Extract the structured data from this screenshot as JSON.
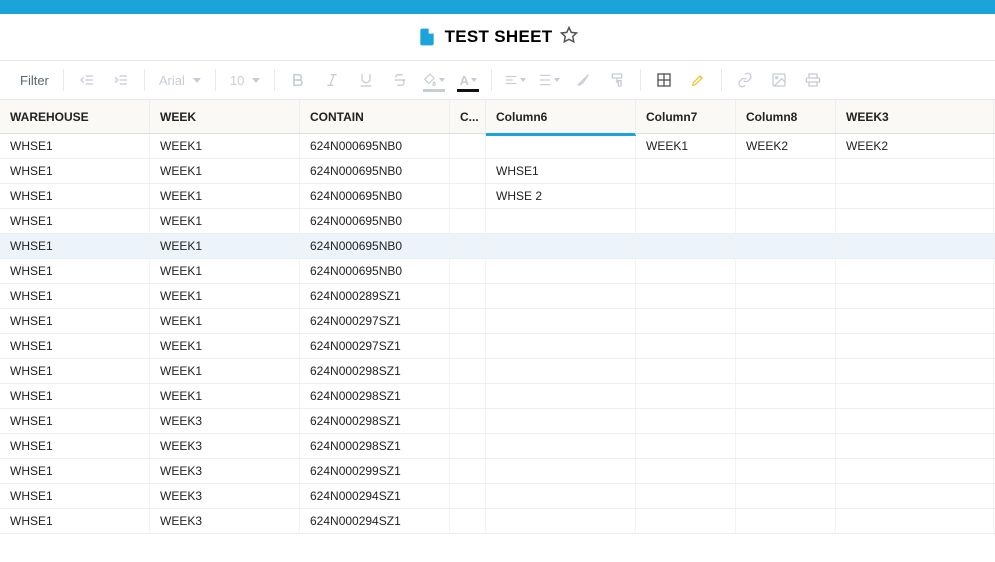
{
  "title": "TEST SHEET",
  "toolbar": {
    "filter_label": "Filter",
    "font_name": "Arial",
    "font_size": "10"
  },
  "columns": [
    {
      "label": "WAREHOUSE"
    },
    {
      "label": "WEEK"
    },
    {
      "label": "CONTAIN"
    },
    {
      "label": "C..."
    },
    {
      "label": "Column6"
    },
    {
      "label": "Column7"
    },
    {
      "label": "Column8"
    },
    {
      "label": "WEEK3"
    }
  ],
  "selected_column_index": 4,
  "highlight_row_index": 4,
  "rows": [
    {
      "c0": "WHSE1",
      "c1": "WEEK1",
      "c2": "624N000695NB0",
      "c3": "",
      "c4": "",
      "c5": "WEEK1",
      "c6": "WEEK2",
      "c7": "WEEK2"
    },
    {
      "c0": "WHSE1",
      "c1": "WEEK1",
      "c2": "624N000695NB0",
      "c3": "",
      "c4": "WHSE1",
      "c5": "",
      "c6": "",
      "c7": ""
    },
    {
      "c0": "WHSE1",
      "c1": "WEEK1",
      "c2": "624N000695NB0",
      "c3": "",
      "c4": "WHSE 2",
      "c5": "",
      "c6": "",
      "c7": ""
    },
    {
      "c0": "WHSE1",
      "c1": "WEEK1",
      "c2": "624N000695NB0",
      "c3": "",
      "c4": "",
      "c5": "",
      "c6": "",
      "c7": ""
    },
    {
      "c0": "WHSE1",
      "c1": "WEEK1",
      "c2": "624N000695NB0",
      "c3": "",
      "c4": "",
      "c5": "",
      "c6": "",
      "c7": ""
    },
    {
      "c0": "WHSE1",
      "c1": "WEEK1",
      "c2": "624N000695NB0",
      "c3": "",
      "c4": "",
      "c5": "",
      "c6": "",
      "c7": ""
    },
    {
      "c0": "WHSE1",
      "c1": "WEEK1",
      "c2": "624N000289SZ1",
      "c3": "",
      "c4": "",
      "c5": "",
      "c6": "",
      "c7": ""
    },
    {
      "c0": "WHSE1",
      "c1": "WEEK1",
      "c2": "624N000297SZ1",
      "c3": "",
      "c4": "",
      "c5": "",
      "c6": "",
      "c7": ""
    },
    {
      "c0": "WHSE1",
      "c1": "WEEK1",
      "c2": "624N000297SZ1",
      "c3": "",
      "c4": "",
      "c5": "",
      "c6": "",
      "c7": ""
    },
    {
      "c0": "WHSE1",
      "c1": "WEEK1",
      "c2": "624N000298SZ1",
      "c3": "",
      "c4": "",
      "c5": "",
      "c6": "",
      "c7": ""
    },
    {
      "c0": "WHSE1",
      "c1": "WEEK1",
      "c2": "624N000298SZ1",
      "c3": "",
      "c4": "",
      "c5": "",
      "c6": "",
      "c7": ""
    },
    {
      "c0": "WHSE1",
      "c1": "WEEK3",
      "c2": "624N000298SZ1",
      "c3": "",
      "c4": "",
      "c5": "",
      "c6": "",
      "c7": ""
    },
    {
      "c0": "WHSE1",
      "c1": "WEEK3",
      "c2": "624N000298SZ1",
      "c3": "",
      "c4": "",
      "c5": "",
      "c6": "",
      "c7": ""
    },
    {
      "c0": "WHSE1",
      "c1": "WEEK3",
      "c2": "624N000299SZ1",
      "c3": "",
      "c4": "",
      "c5": "",
      "c6": "",
      "c7": ""
    },
    {
      "c0": "WHSE1",
      "c1": "WEEK3",
      "c2": "624N000294SZ1",
      "c3": "",
      "c4": "",
      "c5": "",
      "c6": "",
      "c7": ""
    },
    {
      "c0": "WHSE1",
      "c1": "WEEK3",
      "c2": "624N000294SZ1",
      "c3": "",
      "c4": "",
      "c5": "",
      "c6": "",
      "c7": ""
    }
  ]
}
